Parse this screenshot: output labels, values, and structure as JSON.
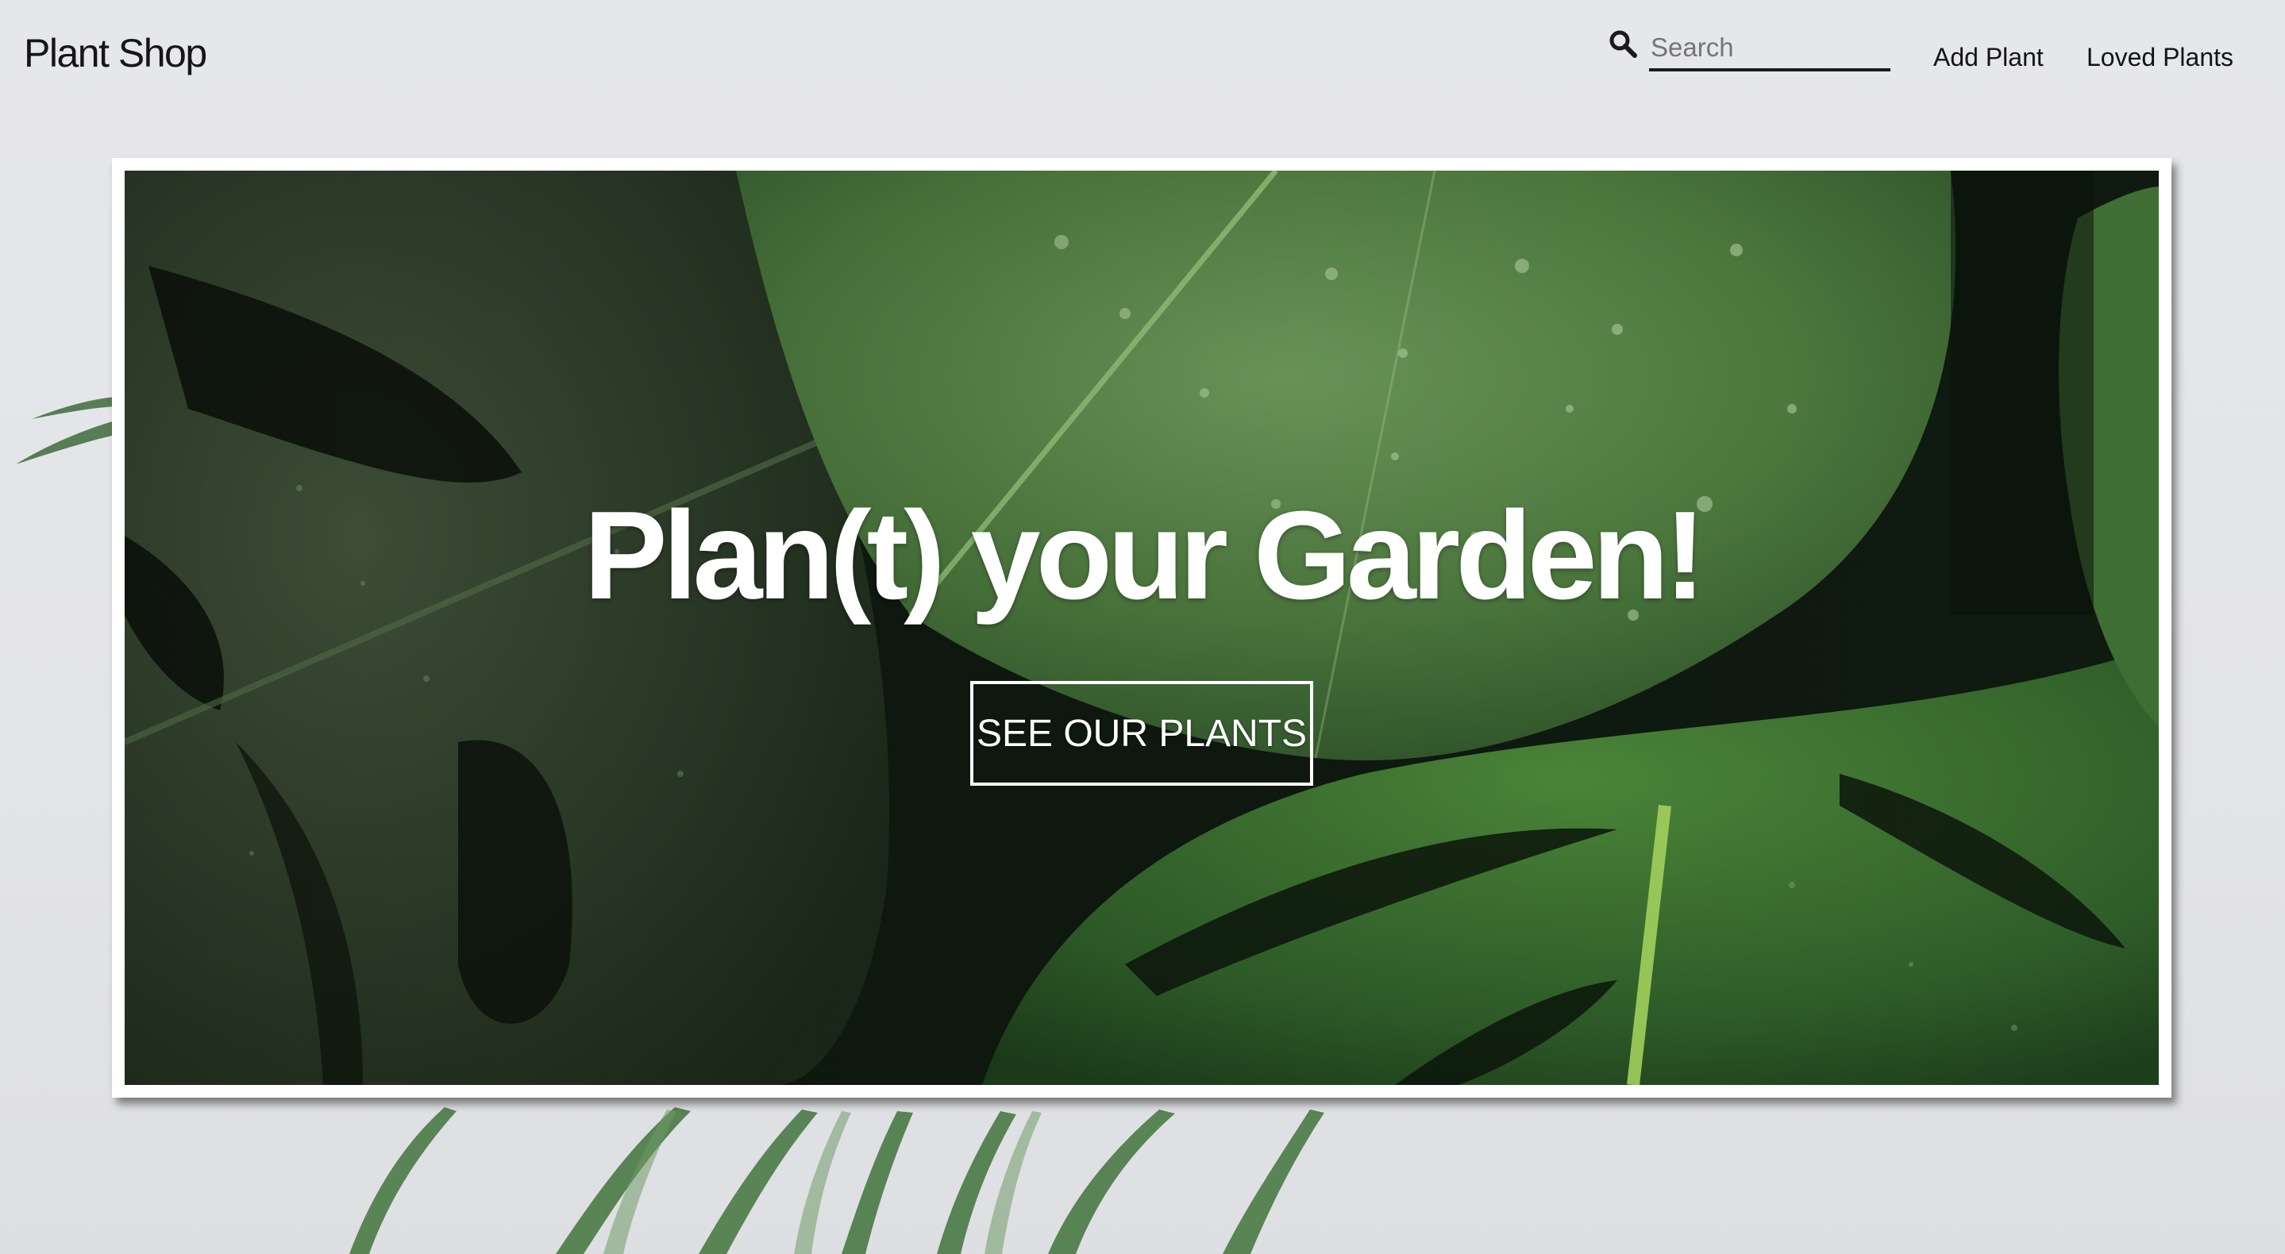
{
  "header": {
    "brand": "Plant Shop",
    "search": {
      "placeholder": "Search",
      "value": ""
    },
    "nav": [
      {
        "label": "Add Plant"
      },
      {
        "label": "Loved Plants"
      }
    ]
  },
  "hero": {
    "title": "Plan(t) your Garden!",
    "cta_label": "SEE OUR PLANTS"
  },
  "icons": {
    "search": "search-icon"
  },
  "colors": {
    "page_background": "#e4e5e8",
    "text_dark": "#161616",
    "leaf_green": "#4f8a3c",
    "hero_text": "#ffffff"
  }
}
